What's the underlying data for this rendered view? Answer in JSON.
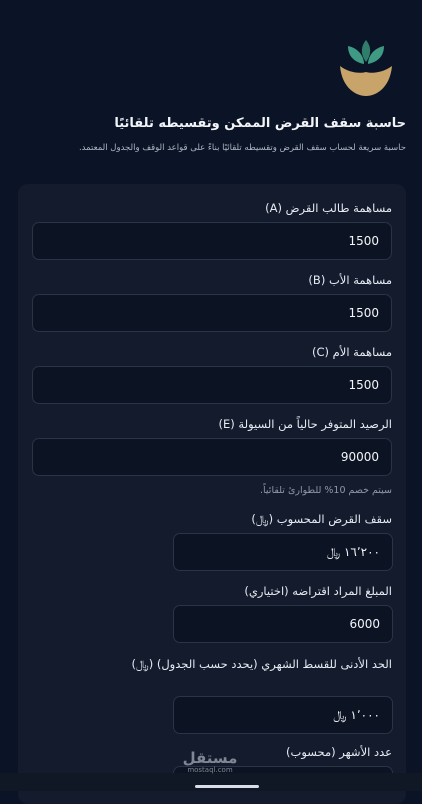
{
  "app": {
    "title": "حاسبة سقف القرض الممكن وتقسيطه تلقائيًا",
    "subtitle": "حاسبة سريعة لحساب سقف القرض وتقسيطه تلقائيًا بناءً على قواعد الوقف والجدول المعتمد."
  },
  "form": {
    "fields": [
      {
        "label": "مساهمة طالب القرض (A)",
        "value": "1500"
      },
      {
        "label": "مساهمة الأب (B)",
        "value": "1500"
      },
      {
        "label": "مساهمة الأم (C)",
        "value": "1500"
      },
      {
        "label": "الرصيد المتوفر حالياً من السيولة (E)",
        "value": "90000"
      }
    ],
    "note": "سيتم خصم 10% للطوارئ تلقائياً.",
    "ceiling": {
      "label": "سقف القرض المحسوب (﷼)",
      "value": "١٦٬٢٠٠ ﷼"
    },
    "desired": {
      "label": "المبلغ المراد اقتراضه (اختياري)",
      "value": "6000"
    },
    "min_installment": {
      "label": "الحد الأدنى للقسط الشهري (يحدد حسب الجدول) (﷼)",
      "value": "١٬٠٠٠ ﷼"
    },
    "months": {
      "label": "عدد الأشهر (محسوب)"
    }
  },
  "watermark": {
    "ar": "مستقل",
    "en": "mostaql.com"
  },
  "colors": {
    "background": "#0b1426",
    "card": "#131b2c",
    "logo_gold": "#c9a46a",
    "logo_green": "#2f7d6a"
  }
}
